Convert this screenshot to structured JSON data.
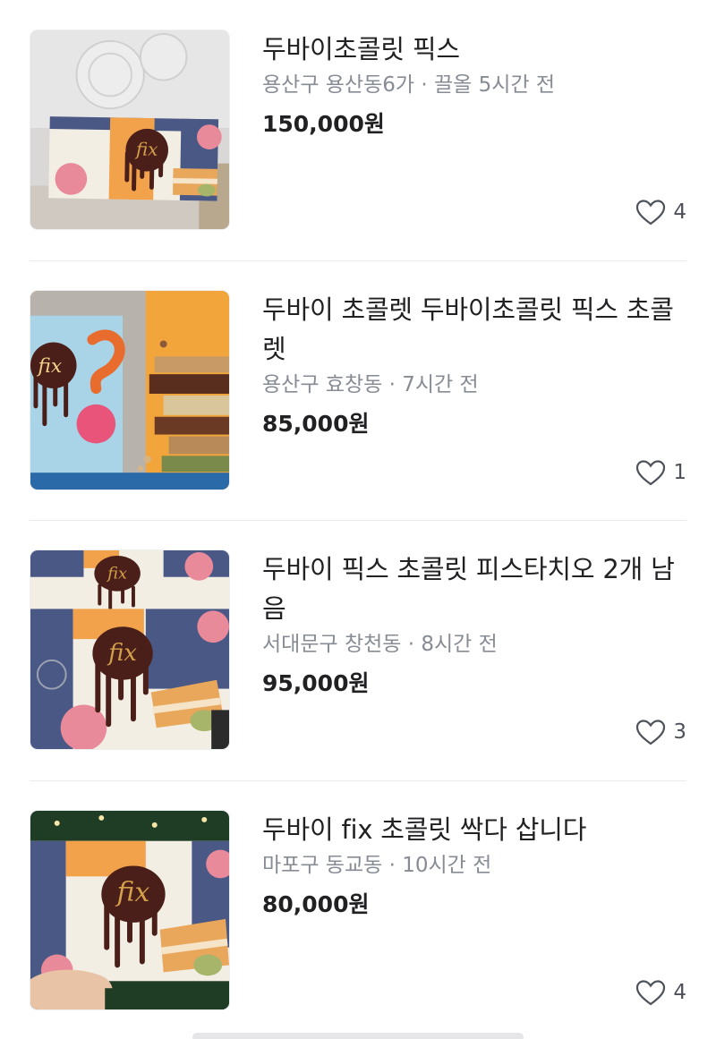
{
  "listings": [
    {
      "title": "두바이초콜릿 픽스",
      "location": "용산구 용산동6가",
      "bump": "끌올 5시간 전",
      "price": "150,000원",
      "likes": "4"
    },
    {
      "title": "두바이 초콜렛 두바이초콜릿 픽스 초콜렛",
      "location": "용산구 효창동",
      "bump": "7시간 전",
      "price": "85,000원",
      "likes": "1"
    },
    {
      "title": "두바이 픽스 초콜릿 피스타치오 2개 남음",
      "location": "서대문구 창천동",
      "bump": "8시간 전",
      "price": "95,000원",
      "likes": "3"
    },
    {
      "title": "두바이 fix 초콜릿 싹다 삽니다",
      "location": "마포구 동교동",
      "bump": "10시간 전",
      "price": "80,000원",
      "likes": "4"
    }
  ],
  "separator": " · ",
  "logo_text": "fix",
  "icons": {
    "like": "heart-outline-icon"
  },
  "colors": {
    "text": "#212124",
    "meta": "#868b94",
    "divider": "#eaebee",
    "chocolate": "#4a1f1a",
    "gold": "#d4a04a"
  }
}
